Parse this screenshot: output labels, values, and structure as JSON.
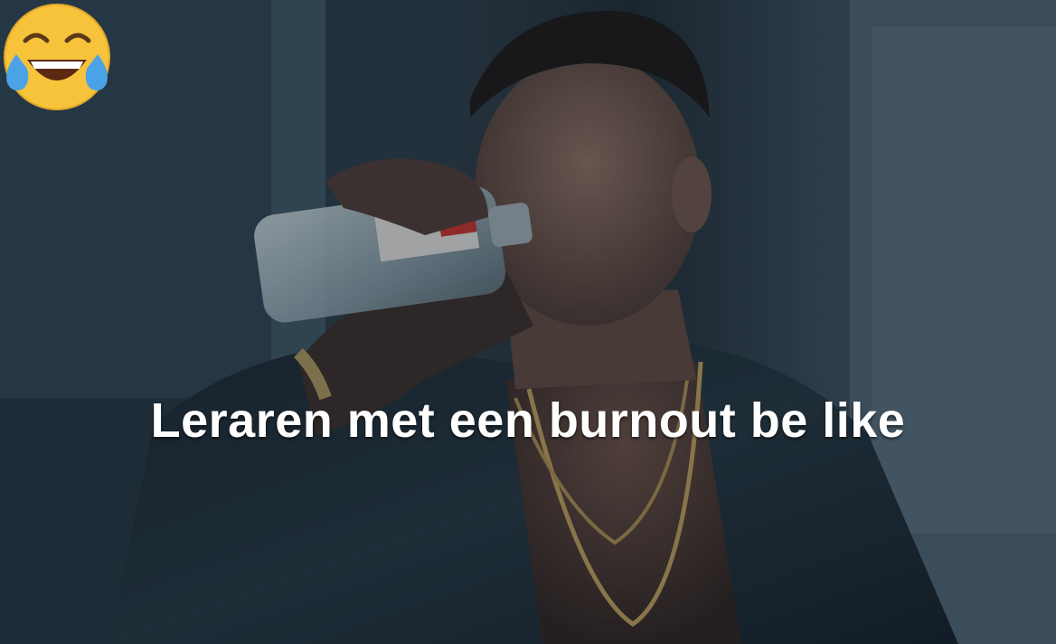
{
  "meme": {
    "caption": "Leraren met een burnout be like",
    "emoji": "face-with-tears-of-joy"
  },
  "colors": {
    "caption_text": "#ffffff",
    "wall": "#334a5a",
    "shadow": "#141c22",
    "skin": "#8a6a5c"
  }
}
